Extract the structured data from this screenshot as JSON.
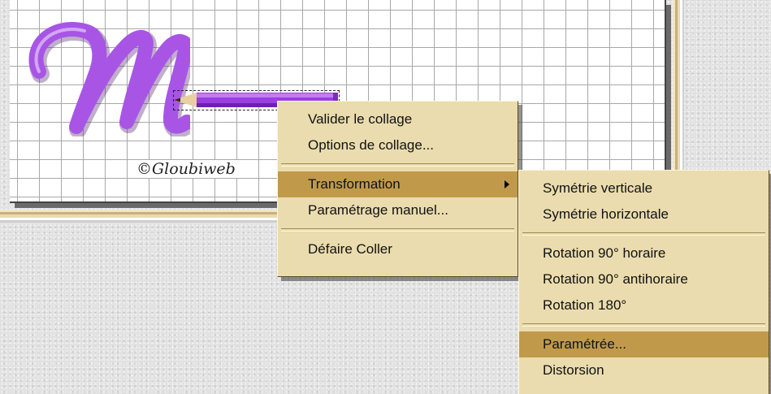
{
  "canvas": {
    "letter": "M",
    "signature": "©Gloubiweb"
  },
  "context_menu": {
    "items": [
      {
        "label": "Valider le collage"
      },
      {
        "label": "Options de collage..."
      },
      {
        "label": "Transformation",
        "has_submenu": true,
        "highlighted": true
      },
      {
        "label": "Paramétrage manuel..."
      },
      {
        "label": "Défaire Coller"
      }
    ]
  },
  "transformation_submenu": {
    "items": [
      {
        "label": "Symétrie verticale"
      },
      {
        "label": "Symétrie horizontale"
      },
      {
        "label": "Rotation 90° horaire"
      },
      {
        "label": "Rotation 90° antihoraire"
      },
      {
        "label": "Rotation 180°"
      },
      {
        "label": "Paramétrée...",
        "highlighted": true
      },
      {
        "label": "Distorsion"
      }
    ]
  },
  "colors": {
    "letter_fill": "#a855e6",
    "menu_background": "#eadcae",
    "menu_highlight": "#c09a4a"
  },
  "icons": [
    "pencil-icon",
    "submenu-arrow-icon"
  ]
}
